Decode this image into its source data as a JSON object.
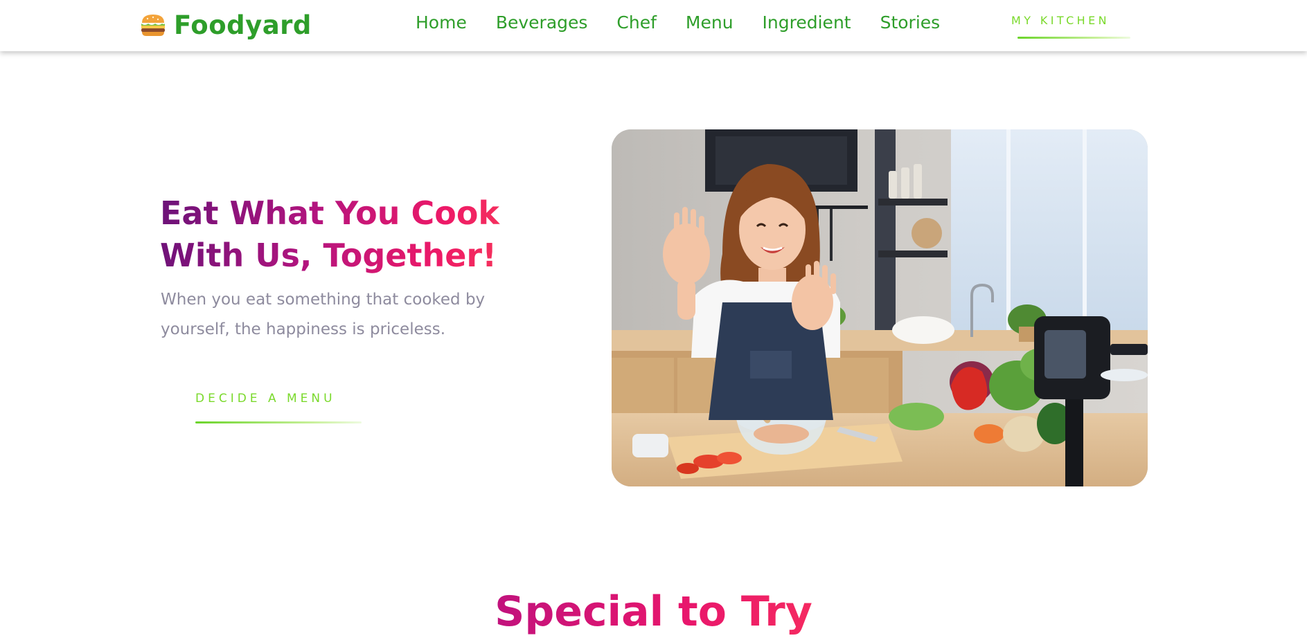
{
  "brand": {
    "name": "Foodyard",
    "logo_icon": "burger-icon",
    "primary_color": "#2e9e2a",
    "accent_color": "#7ad92b"
  },
  "nav": {
    "items": [
      {
        "label": "Home"
      },
      {
        "label": "Beverages"
      },
      {
        "label": "Chef"
      },
      {
        "label": "Menu"
      },
      {
        "label": "Ingredient"
      },
      {
        "label": "Stories"
      }
    ],
    "kitchen_button": "MY KITCHEN"
  },
  "hero": {
    "title_line1": "Eat What You Cook",
    "title_line2": "With Us, Together!",
    "subtitle": "When you eat something that cooked by yourself, the happiness is priceless.",
    "cta_label": "DECIDE A MENU",
    "title_gradient": [
      "#6a1278",
      "#b4147e",
      "#ee1967",
      "#fb4552"
    ],
    "subtitle_color": "#8e8b9e",
    "image": "woman-cooking-in-kitchen-photo"
  },
  "special": {
    "title": "Special to Try",
    "title_color": "#e8166c"
  }
}
